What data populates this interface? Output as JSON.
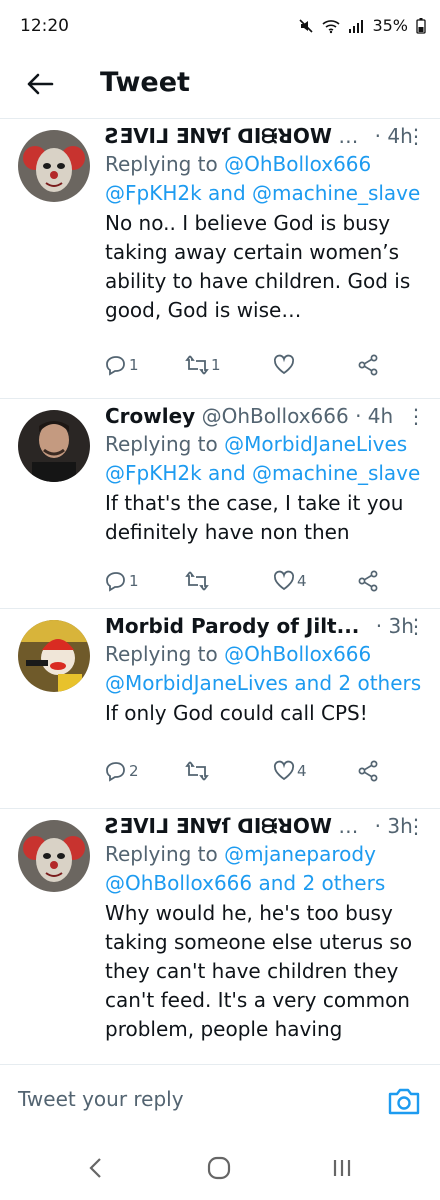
{
  "status_bar": {
    "time": "12:20",
    "battery": "35%"
  },
  "header": {
    "title": "Tweet"
  },
  "tweets": [
    {
      "name": "ƧƎVI⅃ ƎN∀ſ ᗡIᙠꓤOW",
      "ellipsis": "…",
      "time": "· 4h",
      "replying_prefix": "Replying to ",
      "replying_line1_link": "@OhBollox666",
      "replying_line2": "@FpKH2k and @machine_slave",
      "body_lines": [
        "No no.. I believe God is busy",
        "taking away certain women’s",
        "ability to have children. God is",
        "good, God is wise…"
      ],
      "reply_count": "1",
      "retweet_count": "1",
      "like_count": ""
    },
    {
      "name": "Crowley",
      "handle": "@OhBollox666",
      "time": "· 4h",
      "replying_prefix": "Replying to ",
      "replying_line1_link": "@MorbidJaneLives",
      "replying_line2": "@FpKH2k and @machine_slave",
      "body_lines": [
        "If that's the case, I take it you",
        "definitely have non then"
      ],
      "reply_count": "1",
      "retweet_count": "",
      "like_count": "4"
    },
    {
      "name": "Morbid Parody of Jilt...",
      "time": "· 3h",
      "replying_prefix": "Replying to ",
      "replying_line1_link": "@OhBollox666",
      "replying_line2": "@MorbidJaneLives and 2 others",
      "body_lines": [
        "If only God could call CPS!"
      ],
      "reply_count": "2",
      "retweet_count": "",
      "like_count": "4"
    },
    {
      "name": "ƧƎVI⅃ ƎN∀ſ ᗡIᙠꓤOW",
      "ellipsis": "…",
      "time": "· 3h",
      "replying_prefix": "Replying to ",
      "replying_line1_link": "@mjaneparody",
      "replying_line2": "@OhBollox666 and 2 others",
      "body_lines": [
        "Why would he, he's too busy",
        "taking someone else uterus so",
        "they can't have children they",
        "can't feed. It's a very common",
        "problem, people having"
      ]
    }
  ],
  "reply_bar": {
    "placeholder": "Tweet your reply"
  },
  "colors": {
    "link": "#1d9bf0",
    "secondary": "#536471",
    "text": "#0f1419",
    "camera": "#1d9bf0"
  }
}
